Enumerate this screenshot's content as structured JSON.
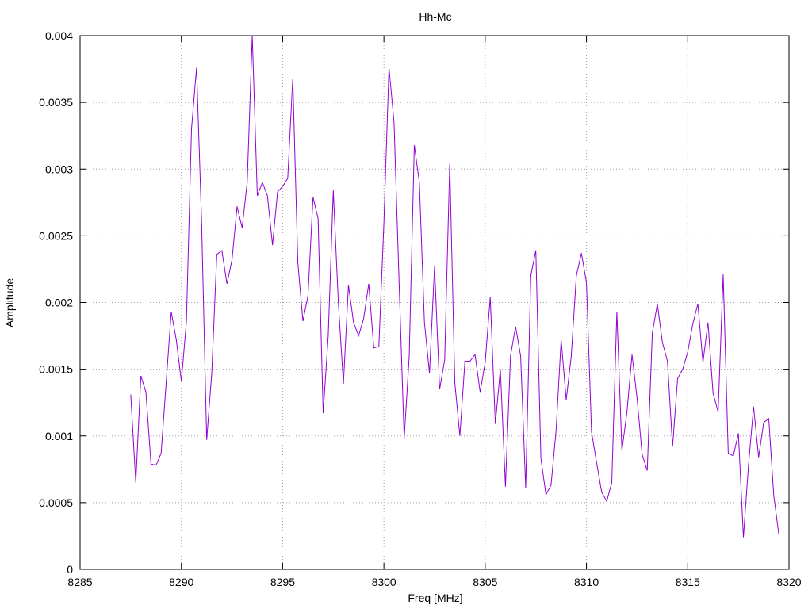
{
  "chart_data": {
    "type": "line",
    "title": "Hh-Mc",
    "xlabel": "Freq [MHz]",
    "ylabel": "Amplitude",
    "xlim": [
      8285,
      8320
    ],
    "ylim": [
      0,
      0.004
    ],
    "grid": true,
    "line_color": "#9400d3",
    "xticks": [
      8285,
      8290,
      8295,
      8300,
      8305,
      8310,
      8315,
      8320
    ],
    "xtick_labels": [
      "8285",
      "8290",
      "8295",
      "8300",
      "8305",
      "8310",
      "8315",
      "8320"
    ],
    "yticks": [
      0,
      0.0005,
      0.001,
      0.0015,
      0.002,
      0.0025,
      0.003,
      0.0035,
      0.004
    ],
    "ytick_labels": [
      "0",
      "0.0005",
      "0.001",
      "0.0015",
      "0.002",
      "0.0025",
      "0.003",
      "0.0035",
      "0.004"
    ],
    "series": [
      {
        "x": [
          8287.5,
          8287.75,
          8288.0,
          8288.25,
          8288.5,
          8288.75,
          8289.0,
          8289.25,
          8289.5,
          8289.75,
          8290.0,
          8290.25,
          8290.5,
          8290.75,
          8291.0,
          8291.25,
          8291.5,
          8291.75,
          8292.0,
          8292.25,
          8292.5,
          8292.75,
          8293.0,
          8293.25,
          8293.5,
          8293.75,
          8294.0,
          8294.25,
          8294.5,
          8294.75,
          8295.0,
          8295.25,
          8295.5,
          8295.75,
          8296.0,
          8296.25,
          8296.5,
          8296.75,
          8297.0,
          8297.25,
          8297.5,
          8297.75,
          8298.0,
          8298.25,
          8298.5,
          8298.75,
          8299.0,
          8299.25,
          8299.5,
          8299.75,
          8300.0,
          8300.25,
          8300.5,
          8300.75,
          8301.0,
          8301.25,
          8301.5,
          8301.75,
          8302.0,
          8302.25,
          8302.5,
          8302.75,
          8303.0,
          8303.25,
          8303.5,
          8303.75,
          8304.0,
          8304.25,
          8304.5,
          8304.75,
          8305.0,
          8305.25,
          8305.5,
          8305.75,
          8306.0,
          8306.25,
          8306.5,
          8306.75,
          8307.0,
          8307.25,
          8307.5,
          8307.75,
          8308.0,
          8308.25,
          8308.5,
          8308.75,
          8309.0,
          8309.25,
          8309.5,
          8309.75,
          8310.0,
          8310.25,
          8310.5,
          8310.75,
          8311.0,
          8311.25,
          8311.5,
          8311.75,
          8312.0,
          8312.25,
          8312.5,
          8312.75,
          8313.0,
          8313.25,
          8313.5,
          8313.75,
          8314.0,
          8314.25,
          8314.5,
          8314.75,
          8315.0,
          8315.25,
          8315.5,
          8315.75,
          8316.0,
          8316.25,
          8316.5,
          8316.75,
          8317.0,
          8317.25,
          8317.5,
          8317.75,
          8318.0,
          8318.25,
          8318.5,
          8318.75,
          8319.0,
          8319.25,
          8319.5
        ],
        "y": [
          0.00131,
          0.00065,
          0.00145,
          0.00133,
          0.00079,
          0.00078,
          0.00087,
          0.0014,
          0.00193,
          0.00172,
          0.00141,
          0.00186,
          0.0033,
          0.00376,
          0.0026,
          0.00097,
          0.00147,
          0.00236,
          0.00239,
          0.00214,
          0.00232,
          0.00272,
          0.00256,
          0.0029,
          0.004,
          0.0028,
          0.0029,
          0.0028,
          0.00243,
          0.00283,
          0.00287,
          0.00293,
          0.00368,
          0.0023,
          0.00186,
          0.00205,
          0.00279,
          0.00263,
          0.00117,
          0.00175,
          0.00284,
          0.002,
          0.00139,
          0.00213,
          0.00185,
          0.00175,
          0.00188,
          0.00214,
          0.00166,
          0.00167,
          0.0026,
          0.00376,
          0.00335,
          0.00215,
          0.00098,
          0.0016,
          0.00318,
          0.0029,
          0.00185,
          0.00147,
          0.00227,
          0.00135,
          0.00157,
          0.00304,
          0.0014,
          0.001,
          0.00156,
          0.00156,
          0.00161,
          0.00133,
          0.00155,
          0.00204,
          0.00109,
          0.0015,
          0.00062,
          0.0016,
          0.00182,
          0.0016,
          0.00061,
          0.0022,
          0.00239,
          0.00083,
          0.00056,
          0.00063,
          0.00104,
          0.00172,
          0.00127,
          0.0016,
          0.0022,
          0.00237,
          0.00215,
          0.00103,
          0.0008,
          0.00058,
          0.00051,
          0.00065,
          0.00193,
          0.00089,
          0.00118,
          0.00161,
          0.00128,
          0.00086,
          0.00074,
          0.00177,
          0.00199,
          0.0017,
          0.00156,
          0.00092,
          0.00143,
          0.0015,
          0.00163,
          0.00184,
          0.00199,
          0.00155,
          0.00185,
          0.00132,
          0.00118,
          0.00221,
          0.00087,
          0.00085,
          0.00102,
          0.00024,
          0.00078,
          0.00122,
          0.00084,
          0.0011,
          0.00113,
          0.00055,
          0.00026
        ]
      }
    ]
  }
}
